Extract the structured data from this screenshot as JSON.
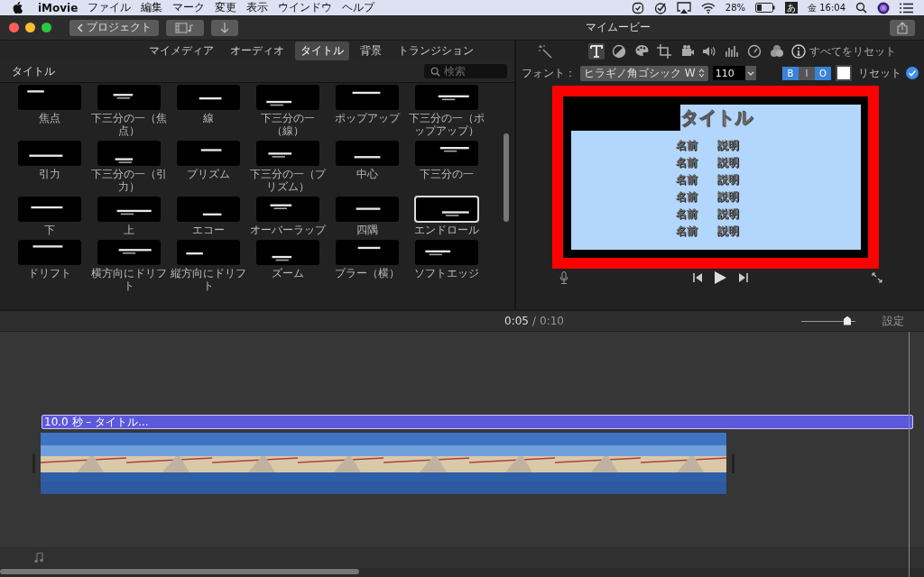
{
  "menubar": {
    "app": "iMovie",
    "items": [
      "ファイル",
      "編集",
      "マーク",
      "変更",
      "表示",
      "ウインドウ",
      "ヘルプ"
    ],
    "battery": "28%",
    "ime": "あ",
    "clock": "金 16:04"
  },
  "toolbar": {
    "back_button": "プロジェクト",
    "title": "マイムービー"
  },
  "browser_tabs": [
    {
      "label": "マイメディア",
      "selected": false
    },
    {
      "label": "オーディオ",
      "selected": false
    },
    {
      "label": "タイトル",
      "selected": true
    },
    {
      "label": "背景",
      "selected": false
    },
    {
      "label": "トランジション",
      "selected": false
    }
  ],
  "browser": {
    "heading": "タイトル",
    "search_placeholder": "検索",
    "titles": [
      {
        "label": "焦点",
        "selected": false
      },
      {
        "label": "下三分の一（焦点）",
        "selected": false
      },
      {
        "label": "線",
        "selected": false
      },
      {
        "label": "下三分の一（線）",
        "selected": false
      },
      {
        "label": "ポップアップ",
        "selected": false
      },
      {
        "label": "下三分の一（ポップアップ）",
        "selected": false
      },
      {
        "label": "引力",
        "selected": false
      },
      {
        "label": "下三分の一（引力）",
        "selected": false
      },
      {
        "label": "プリズム",
        "selected": false
      },
      {
        "label": "下三分の一（プリズム）",
        "selected": false
      },
      {
        "label": "中心",
        "selected": false
      },
      {
        "label": "下三分の一",
        "selected": false
      },
      {
        "label": "下",
        "selected": false
      },
      {
        "label": "上",
        "selected": false
      },
      {
        "label": "エコー",
        "selected": false
      },
      {
        "label": "オーバーラップ",
        "selected": false
      },
      {
        "label": "四隅",
        "selected": false
      },
      {
        "label": "エンドロール",
        "selected": true
      },
      {
        "label": "ドリフト",
        "selected": false
      },
      {
        "label": "横方向にドリフト",
        "selected": false
      },
      {
        "label": "縦方向にドリフト",
        "selected": false
      },
      {
        "label": "ズーム",
        "selected": false
      },
      {
        "label": "ブラー（横）",
        "selected": false
      },
      {
        "label": "ソフトエッジ",
        "selected": false
      }
    ]
  },
  "inspector": {
    "tools": [
      {
        "kind": "text",
        "selected": true
      },
      {
        "kind": "balance",
        "selected": false
      },
      {
        "kind": "palette",
        "selected": false
      },
      {
        "kind": "crop",
        "selected": false
      },
      {
        "kind": "camera",
        "selected": false
      },
      {
        "kind": "volume",
        "selected": false
      },
      {
        "kind": "equalizer",
        "selected": false
      },
      {
        "kind": "speed",
        "selected": false
      },
      {
        "kind": "filters",
        "selected": false
      }
    ],
    "reset_all": "すべてをリセット",
    "font_label": "フォント：",
    "font": "ヒラギノ角ゴシック W",
    "size": "110",
    "style_buttons": [
      {
        "label": "B",
        "on": true
      },
      {
        "label": "I",
        "on": false
      },
      {
        "label": "O",
        "on": true
      }
    ],
    "reset": "リセット"
  },
  "viewer": {
    "title": "タイトル",
    "credits": [
      {
        "name": "名前",
        "desc": "説明"
      },
      {
        "name": "名前",
        "desc": "説明"
      },
      {
        "name": "名前",
        "desc": "説明"
      },
      {
        "name": "名前",
        "desc": "説明"
      },
      {
        "name": "名前",
        "desc": "説明"
      },
      {
        "name": "名前",
        "desc": "説明"
      }
    ]
  },
  "timeline": {
    "current": "0:05",
    "separator": "/",
    "total": "0:10",
    "zoom": {
      "level": 0.85
    },
    "settings": "設定",
    "title_clip": "10.0 秒 – タイトル..."
  }
}
